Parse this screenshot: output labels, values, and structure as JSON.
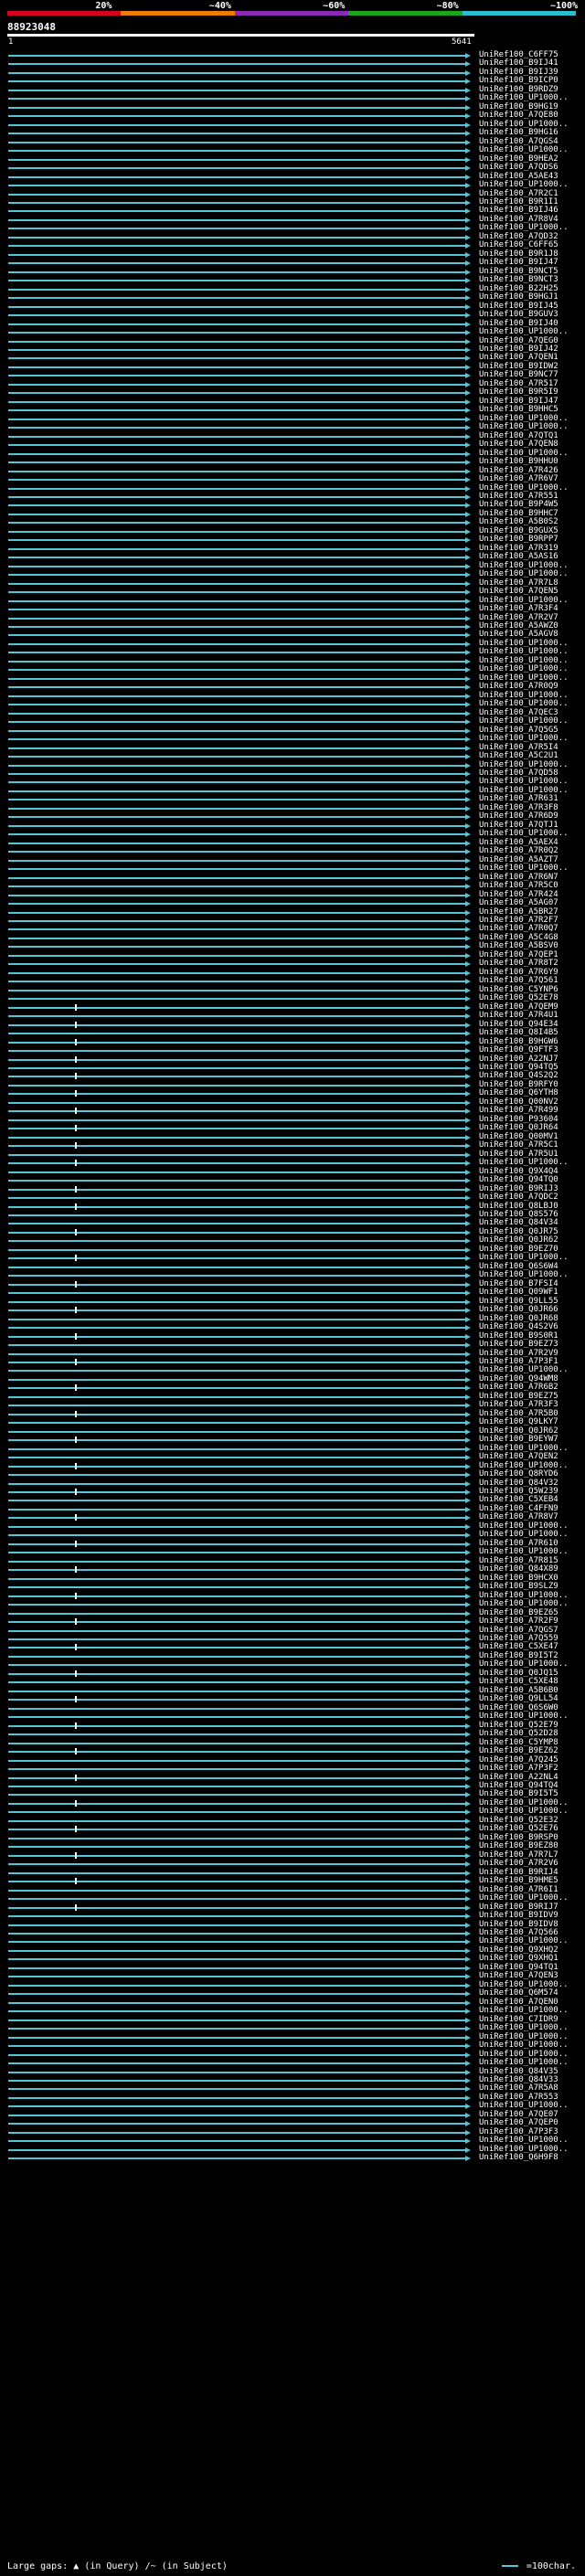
{
  "scale": {
    "colors": [
      "#d7001c",
      "#ef7b00",
      "#8b2bb5",
      "#1aa81a",
      "#29bfcf"
    ],
    "labels": [
      "20%",
      "~40%",
      "~60%",
      "~80%",
      "~100%"
    ]
  },
  "query": {
    "id": "88923048",
    "start": "1",
    "end": "5641"
  },
  "hit_color": "#53c5d6",
  "hits": [
    "UniRef100_C6FF75",
    "UniRef100_B9IJ41",
    "UniRef100_B9IJ39",
    "UniRef100_B9ICP0",
    "UniRef100_B9RDZ9",
    "UniRef100_UP1000..",
    "UniRef100_B9HG19",
    "UniRef100_A7QE80",
    "UniRef100_UP1000..",
    "UniRef100_B9HG16",
    "UniRef100_A7QGS4",
    "UniRef100_UP1000..",
    "UniRef100_B9HEA2",
    "UniRef100_A7QDS6",
    "UniRef100_A5AE43",
    "UniRef100_UP1000..",
    "UniRef100_A7R2C1",
    "UniRef100_B9R1I1",
    "UniRef100_B9IJ46",
    "UniRef100_A7R8V4",
    "UniRef100_UP1000..",
    "UniRef100_A7QD32",
    "UniRef100_C6FF65",
    "UniRef100_B9R1J8",
    "UniRef100_B9IJ47",
    "UniRef100_B9NCT5",
    "UniRef100_B9NCT3",
    "UniRef100_B22H25",
    "UniRef100_B9HGJ1",
    "UniRef100_B9IJ45",
    "UniRef100_B9GUV3",
    "UniRef100_B9IJ40",
    "UniRef100_UP1000..",
    "UniRef100_A7QEG0",
    "UniRef100_B9IJ42",
    "UniRef100_A7QEN1",
    "UniRef100_B9IDW2",
    "UniRef100_B9NC77",
    "UniRef100_A7R517",
    "UniRef100_B9R5I9",
    "UniRef100_B9IJ47",
    "UniRef100_B9HHC5",
    "UniRef100_UP1000..",
    "UniRef100_UP1000..",
    "UniRef100_A7QTQ1",
    "UniRef100_A7QEN8",
    "UniRef100_UP1000..",
    "UniRef100_B9HHU0",
    "UniRef100_A7R426",
    "UniRef100_A7R6V7",
    "UniRef100_UP1000..",
    "UniRef100_A7R551",
    "UniRef100_B9P4W5",
    "UniRef100_B9HHC7",
    "UniRef100_A5B0S2",
    "UniRef100_B9GUX5",
    "UniRef100_B9RPP7",
    "UniRef100_A7R319",
    "UniRef100_A5AS16",
    "UniRef100_UP1000..",
    "UniRef100_UP1000..",
    "UniRef100_A7R7L8",
    "UniRef100_A7QEN5",
    "UniRef100_UP1000..",
    "UniRef100_A7R3F4",
    "UniRef100_A7R2V7",
    "UniRef100_A5AWZ0",
    "UniRef100_A5AGV8",
    "UniRef100_UP1000..",
    "UniRef100_UP1000..",
    "UniRef100_UP1000..",
    "UniRef100_UP1000..",
    "UniRef100_UP1000..",
    "UniRef100_A7R0Q9",
    "UniRef100_UP1000..",
    "UniRef100_UP1000..",
    "UniRef100_A7QEC3",
    "UniRef100_UP1000..",
    "UniRef100_A7Q5G5",
    "UniRef100_UP1000..",
    "UniRef100_A7R5I4",
    "UniRef100_A5C2U1",
    "UniRef100_UP1000..",
    "UniRef100_A7QD58",
    "UniRef100_UP1000..",
    "UniRef100_UP1000..",
    "UniRef100_A7R631",
    "UniRef100_A7R3F8",
    "UniRef100_A7R6D9",
    "UniRef100_A7QTJ1",
    "UniRef100_UP1000..",
    "UniRef100_A5AEX4",
    "UniRef100_A7R0Q2",
    "UniRef100_A5AZT7",
    "UniRef100_UP1000..",
    "UniRef100_A7R6N7",
    "UniRef100_A7R5C0",
    "UniRef100_A7R424",
    "UniRef100_A5AG07",
    "UniRef100_A5BR27",
    "UniRef100_A7R2F7",
    "UniRef100_A7R0Q7",
    "UniRef100_A5C4G8",
    "UniRef100_A5BSV0",
    "UniRef100_A7QEP1",
    "UniRef100_A7R8T2",
    "UniRef100_A7R6Y9",
    "UniRef100_A7Q561",
    "UniRef100_C5YNP6",
    "UniRef100_Q52E78",
    "UniRef100_A7QEM9",
    "UniRef100_A7R4U1",
    "UniRef100_Q94E34",
    "UniRef100_Q8I4B5",
    "UniRef100_B9HGW6",
    "UniRef100_Q9FTF3",
    "UniRef100_A22NJ7",
    "UniRef100_Q94TQ5",
    "UniRef100_Q4S2Q2",
    "UniRef100_B9RFY0",
    "UniRef100_Q6YTH8",
    "UniRef100_Q00NV2",
    "UniRef100_A7R499",
    "UniRef100_P93604",
    "UniRef100_Q0JR64",
    "UniRef100_Q00MV1",
    "UniRef100_A7R5C1",
    "UniRef100_A7R5U1",
    "UniRef100_UP1000..",
    "UniRef100_Q9X4Q4",
    "UniRef100_Q94TQ0",
    "UniRef100_B9RIJ3",
    "UniRef100_A7QDC2",
    "UniRef100_Q8LBJ0",
    "UniRef100_Q8S576",
    "UniRef100_Q84V34",
    "UniRef100_Q0JR75",
    "UniRef100_Q0JR62",
    "UniRef100_B9EZ70",
    "UniRef100_UP1000..",
    "UniRef100_Q6S6W4",
    "UniRef100_UP1000..",
    "UniRef100_B7FSI4",
    "UniRef100_Q09WF1",
    "UniRef100_Q9LL55",
    "UniRef100_Q0JR66",
    "UniRef100_Q0JR68",
    "UniRef100_Q4S2V6",
    "UniRef100_B9S0R1",
    "UniRef100_B9EZ73",
    "UniRef100_A7R2V9",
    "UniRef100_A7P3F1",
    "UniRef100_UP1000..",
    "UniRef100_Q94WM8",
    "UniRef100_A7R6B2",
    "UniRef100_B9EZ75",
    "UniRef100_A7R3F3",
    "UniRef100_A7R5B0",
    "UniRef100_Q9LKY7",
    "UniRef100_Q0JR62",
    "UniRef100_B9EYW7",
    "UniRef100_UP1000..",
    "UniRef100_A7QEN2",
    "UniRef100_UP1000..",
    "UniRef100_Q8RYD6",
    "UniRef100_Q84V32",
    "UniRef100_Q5W239",
    "UniRef100_C5XEB4",
    "UniRef100_C4FFN9",
    "UniRef100_A7R8V7",
    "UniRef100_UP1000..",
    "UniRef100_UP1000..",
    "UniRef100_A7R610",
    "UniRef100_UP1000..",
    "UniRef100_A7R815",
    "UniRef100_Q84X89",
    "UniRef100_B9HCX0",
    "UniRef100_B9SLZ9",
    "UniRef100_UP1000..",
    "UniRef100_UP1000..",
    "UniRef100_B9EZ65",
    "UniRef100_A7R2F9",
    "UniRef100_A7QGS7",
    "UniRef100_A7Q559",
    "UniRef100_C5XE47",
    "UniRef100_B9I5T2",
    "UniRef100_UP1000..",
    "UniRef100_Q0JQ15",
    "UniRef100_C5XE48",
    "UniRef100_A5B6B0",
    "UniRef100_Q9LL54",
    "UniRef100_Q6S6W0",
    "UniRef100_UP1000..",
    "UniRef100_Q52E79",
    "UniRef100_Q52D28",
    "UniRef100_C5YMP8",
    "UniRef100_B9EZ62",
    "UniRef100_A7Q245",
    "UniRef100_A7P3F2",
    "UniRef100_A22NL4",
    "UniRef100_Q94TQ4",
    "UniRef100_B9I5T5",
    "UniRef100_UP1000..",
    "UniRef100_UP1000..",
    "UniRef100_Q52E32",
    "UniRef100_Q52E76",
    "UniRef100_B9RSP0",
    "UniRef100_B9EZ80",
    "UniRef100_A7R7L7",
    "UniRef100_A7R2V6",
    "UniRef100_B9RIJ4",
    "UniRef100_B9HME5",
    "UniRef100_A7R6I1",
    "UniRef100_UP1000..",
    "UniRef100_B9RIJ7",
    "UniRef100_B9IDV9",
    "UniRef100_B9IDV8",
    "UniRef100_A7Q566",
    "UniRef100_UP1000..",
    "UniRef100_Q9XHQ2",
    "UniRef100_Q9XHQ1",
    "UniRef100_Q94TQ1",
    "UniRef100_A7QEN3",
    "UniRef100_UP1000..",
    "UniRef100_Q6M574",
    "UniRef100_A7QEN0",
    "UniRef100_UP1000..",
    "UniRef100_C7IDR9",
    "UniRef100_UP1000..",
    "UniRef100_UP1000..",
    "UniRef100_UP1000..",
    "UniRef100_UP1000..",
    "UniRef100_UP1000..",
    "UniRef100_Q84V35",
    "UniRef100_Q84V33",
    "UniRef100_A7R5A8",
    "UniRef100_A7R553",
    "UniRef100_UP1000..",
    "UniRef100_A7QE07",
    "UniRef100_A7QEP0",
    "UniRef100_A7P3F3",
    "UniRef100_UP1000..",
    "UniRef100_UP1000..",
    "UniRef100_Q6H9F8"
  ],
  "footer": {
    "large_gaps": "Large gaps:",
    "in_query": "(in Query)",
    "in_subject": "/~ (in Subject)",
    "scale_key": "=100char."
  }
}
